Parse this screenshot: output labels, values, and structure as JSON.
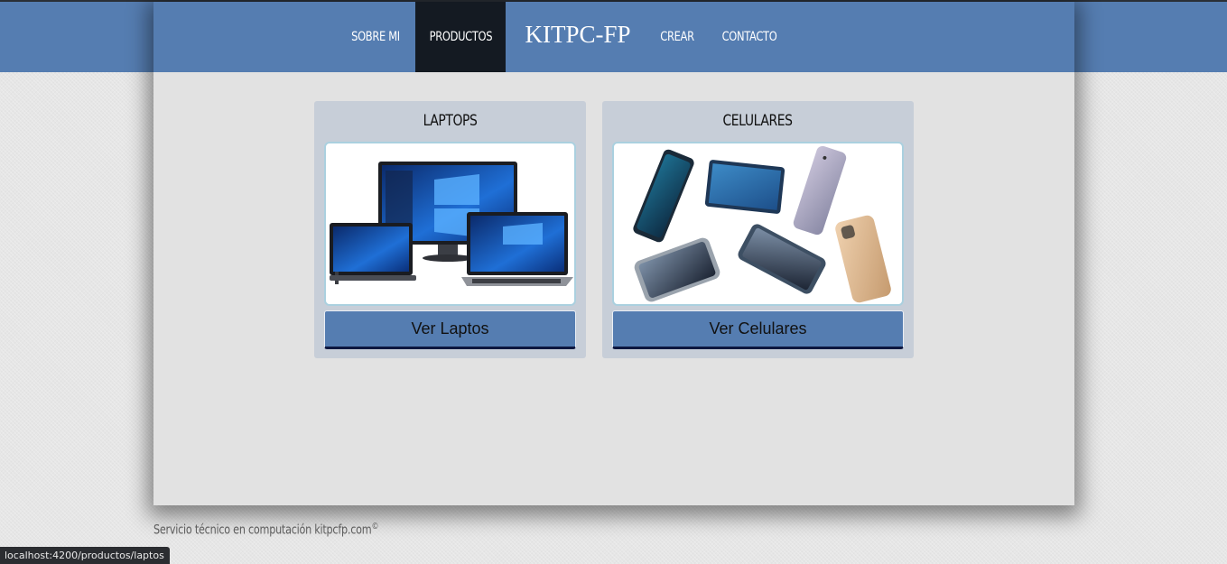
{
  "nav": {
    "items": [
      {
        "label": "SOBRE MI"
      },
      {
        "label": "PRODUCTOS",
        "active": true
      },
      {
        "label": "CREAR"
      },
      {
        "label": "CONTACTO"
      }
    ],
    "brand": "KITPC-FP"
  },
  "cards": [
    {
      "title": "LAPTOPS",
      "button": "Ver Laptos",
      "image": "laptops-devices-image"
    },
    {
      "title": "CELULARES",
      "button": "Ver Celulares",
      "image": "smartphones-image"
    }
  ],
  "footer": {
    "text": "Servicio técnico en computación kitpcfp.com",
    "symbol": "©"
  },
  "statusbar": {
    "url": "localhost:4200/productos/laptos"
  },
  "colors": {
    "header": "#557db1",
    "active_nav": "#141a22",
    "button": "#557db1",
    "card": "#c7ced8"
  }
}
